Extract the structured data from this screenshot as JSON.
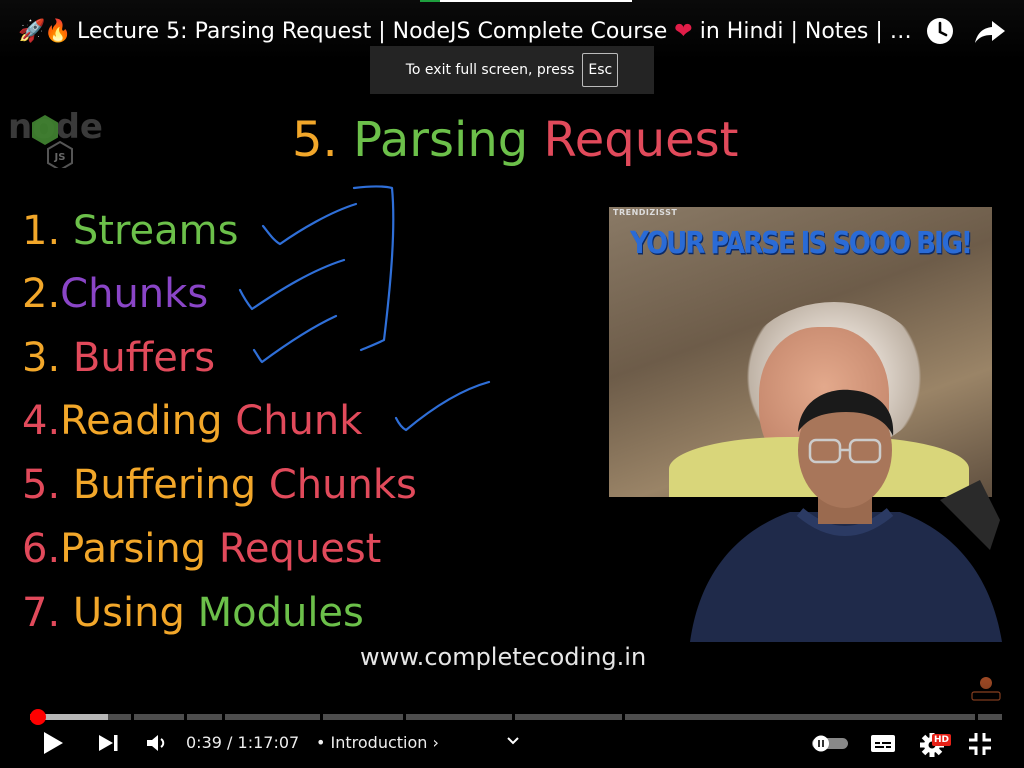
{
  "header": {
    "title_emoji_1": "🚀",
    "title_emoji_2": "🔥",
    "title_text": "Lecture 5: Parsing Request | NodeJS Complete Course",
    "title_heart": "❤",
    "title_suffix": "in Hindi | Notes | …",
    "watch_later_icon": "clock-icon",
    "share_icon": "share-arrow-icon"
  },
  "fullscreen_toast": {
    "message": "To exit full screen, press",
    "key": "Esc"
  },
  "slide": {
    "logo_text": "node",
    "logo_badge": "JS",
    "title_number": "5.",
    "title_word_1": "Parsing",
    "title_word_2": "Request",
    "topics": [
      {
        "number": "1.",
        "parts": [
          "Streams"
        ]
      },
      {
        "number": "2.",
        "parts": [
          "Chunks"
        ]
      },
      {
        "number": "3.",
        "parts": [
          "Buffers"
        ]
      },
      {
        "number": "4.",
        "parts": [
          "Reading",
          "Chunk"
        ]
      },
      {
        "number": "5.",
        "parts": [
          "Buffering",
          "Chunks"
        ]
      },
      {
        "number": "6.",
        "parts": [
          "Parsing",
          "Request"
        ]
      },
      {
        "number": "7.",
        "parts": [
          "Using",
          "Modules"
        ]
      }
    ],
    "meme_watermark": "TRENDIZISST",
    "meme_caption": "YOUR PARSE IS SOOO BIG!",
    "website": "www.completecoding.in",
    "colors": {
      "yellow": "#f2a72a",
      "green": "#6cc04a",
      "red": "#e14a5b",
      "purple": "#8a45c7",
      "annotation_blue": "#2f6fd8"
    }
  },
  "player": {
    "current_time": "0:39",
    "duration": "1:17:07",
    "time_separator": "/",
    "chapter_prefix": "•",
    "chapter": "Introduction",
    "chapter_chevron": "›",
    "played_fraction": 0.008,
    "buffered_fraction": 0.08,
    "quality_badge": "HD",
    "accent_color": "#ff0000",
    "icons": {
      "play": "play-icon",
      "next": "next-icon",
      "volume": "volume-icon",
      "dropdown": "chevron-down-icon",
      "autoplay": "autoplay-toggle-icon",
      "captions": "captions-icon",
      "settings": "gear-icon",
      "exit_fullscreen": "exit-fullscreen-icon"
    }
  }
}
